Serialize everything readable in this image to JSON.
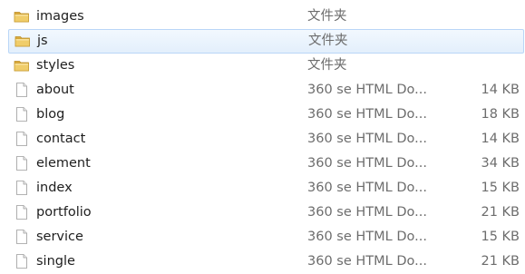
{
  "files": [
    {
      "name": "images",
      "type": "文件夹",
      "size": "",
      "kind": "folder",
      "icon": "folder-icon",
      "selected": false
    },
    {
      "name": "js",
      "type": "文件夹",
      "size": "",
      "kind": "folder",
      "icon": "folder-icon",
      "selected": true
    },
    {
      "name": "styles",
      "type": "文件夹",
      "size": "",
      "kind": "folder",
      "icon": "folder-icon",
      "selected": false
    },
    {
      "name": "about",
      "type": "360 se HTML Do...",
      "size": "14 KB",
      "kind": "file",
      "icon": "document-icon",
      "selected": false
    },
    {
      "name": "blog",
      "type": "360 se HTML Do...",
      "size": "18 KB",
      "kind": "file",
      "icon": "document-icon",
      "selected": false
    },
    {
      "name": "contact",
      "type": "360 se HTML Do...",
      "size": "14 KB",
      "kind": "file",
      "icon": "document-icon",
      "selected": false
    },
    {
      "name": "element",
      "type": "360 se HTML Do...",
      "size": "34 KB",
      "kind": "file",
      "icon": "document-icon",
      "selected": false
    },
    {
      "name": "index",
      "type": "360 se HTML Do...",
      "size": "15 KB",
      "kind": "file",
      "icon": "document-icon",
      "selected": false
    },
    {
      "name": "portfolio",
      "type": "360 se HTML Do...",
      "size": "21 KB",
      "kind": "file",
      "icon": "document-icon",
      "selected": false
    },
    {
      "name": "service",
      "type": "360 se HTML Do...",
      "size": "15 KB",
      "kind": "file",
      "icon": "document-icon",
      "selected": false
    },
    {
      "name": "single",
      "type": "360 se HTML Do...",
      "size": "21 KB",
      "kind": "file",
      "icon": "document-icon",
      "selected": false
    }
  ],
  "colors": {
    "selection_fill": "#e3effc",
    "selection_border": "#b9d6f7",
    "folder": "#e9c25a",
    "secondary_text": "#6d6d6d"
  }
}
